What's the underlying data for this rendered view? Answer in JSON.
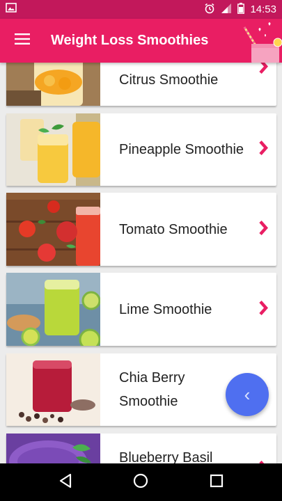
{
  "status_bar": {
    "time": "14:53",
    "icons": [
      "image-icon",
      "alarm-icon",
      "signal-icon",
      "battery-icon"
    ]
  },
  "app_bar": {
    "title": "Weight Loss Smoothies",
    "menu_icon": "hamburger-menu-icon",
    "decor_icon": "smoothie-jar-icon"
  },
  "smoothies": [
    {
      "name": "Citrus Smoothie"
    },
    {
      "name": "Pineapple Smoothie"
    },
    {
      "name": "Tomato Smoothie"
    },
    {
      "name": "Lime Smoothie"
    },
    {
      "name": "Chia Berry Smoothie"
    },
    {
      "name": "Blueberry Basil"
    }
  ],
  "fab": {
    "label": "‹",
    "icon": "chevron-left-icon"
  },
  "nav_bar": {
    "icons": [
      "back-icon",
      "home-icon",
      "recents-icon"
    ]
  },
  "colors": {
    "primary": "#e91e63",
    "primary_dark": "#c2185b",
    "accent_chevron": "#e91e63",
    "fab": "#4f6ff0"
  }
}
